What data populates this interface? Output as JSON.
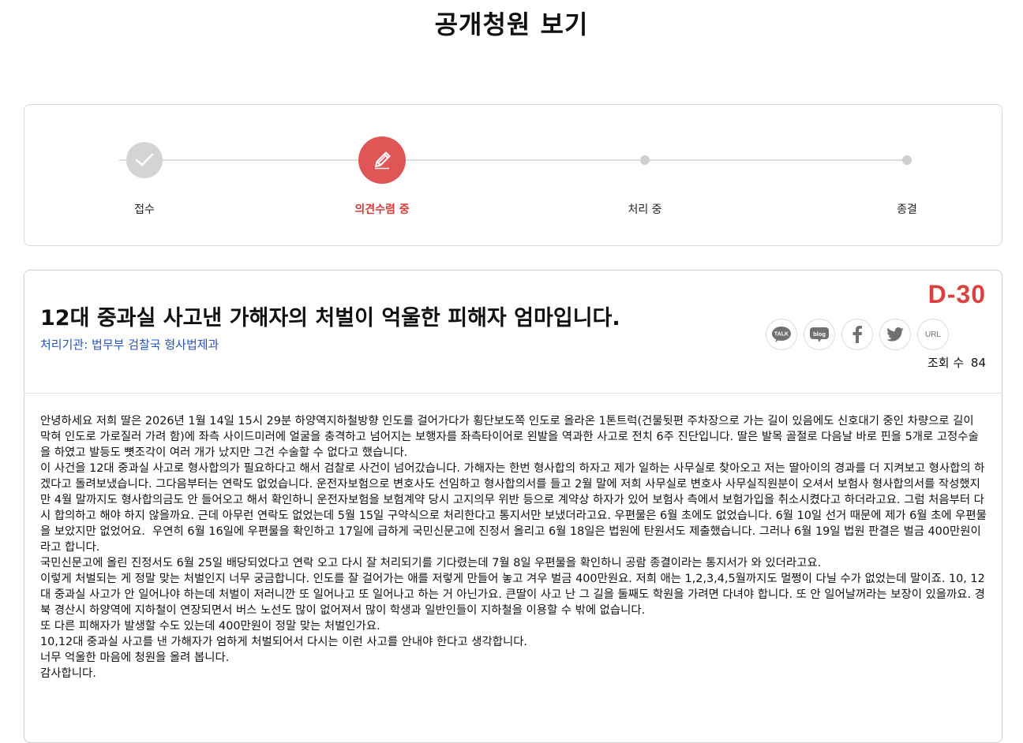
{
  "page": {
    "title": "공개청원 보기"
  },
  "progress": {
    "steps": [
      {
        "label": "접수",
        "state": "done"
      },
      {
        "label": "의견수렴 중",
        "state": "active"
      },
      {
        "label": "처리 중",
        "state": "pending"
      },
      {
        "label": "종결",
        "state": "pending"
      }
    ]
  },
  "petition": {
    "title": "12대 중과실 사고낸 가해자의 처벌이 억울한 피해자 엄마입니다.",
    "agency": "처리기관: 법무부 검찰국 형사법제과",
    "dday": "D-30",
    "views_label": "조회 수",
    "views_count": "84",
    "share": [
      {
        "name": "kakaotalk",
        "text": "TALK"
      },
      {
        "name": "blog",
        "text": "blog"
      },
      {
        "name": "facebook",
        "text": ""
      },
      {
        "name": "twitter",
        "text": ""
      },
      {
        "name": "url",
        "text": "URL"
      }
    ],
    "body": "안녕하세요 저희 딸은 2026년 1월 14일 15시 29분 하양역지하철방향 인도를 걸어가다가 횡단보도쪽 인도로 올라온 1톤트럭(건물뒷편 주차장으로 가는 길이 있음에도 신호대기 중인 차량으로 길이 막혀 인도로 가로질러 가려 함)에 좌측 사이드미러에 얼굴을 충격하고 넘어지는 보행자를 좌측타이어로 왼발을 역과한 사고로 전치 6주 진단입니다. 딸은 발목 골절로 다음날 바로 핀을 5개로 고정수술을 하였고 발등도 뼛조각이 여러 개가 났지만 그건 수술할 수 없다고 했습니다.\n이 사건을 12대 중과실 사고로 형사합의가 필요하다고 해서 검찰로 사건이 넘어갔습니다. 가해자는 한번 형사합의 하자고 제가 일하는 사무실로 찾아오고 저는 딸아이의 경과를 더 지켜보고 형사합의 하겠다고 돌려보냈습니다. 그다음부터는 연락도 없었습니다. 운전자보험으로 변호사도 선임하고 형사합의서를 들고 2월 말에 저희 사무실로 변호사 사무실직원분이 오셔서 보험사 형사합의서를 작성했지만 4월 말까지도 형사합의금도 안 들어오고 해서 확인하니 운전자보험을 보험계약 당시 고지의무 위반 등으로 계약상 하자가 있어 보험사 측에서 보험가입을 취소시켰다고 하더라고요. 그럼 처음부터 다시 합의하고 해야 하지 않을까요. 근데 아무런 연락도 없었는데 5월 15일 구약식으로 처리한다고 통지서만 보냈더라고요. 우편물은 6월 초에도 없었습니다. 6월 10일 선거 때문에 제가 6월 초에 우편물을 보았지만 없었어요.  우연히 6월 16일에 우편물을 확인하고 17일에 급하게 국민신문고에 진정서 올리고 6월 18일은 법원에 탄원서도 제출했습니다. 그러나 6월 19일 법원 판결은 벌금 400만원이라고 합니다.\n국민신문고에 올린 진정서도 6월 25일 배당되었다고 연락 오고 다시 잘 처리되기를 기다렸는데 7월 8일 우편물을 확인하니 공람 종결이라는 통지서가 와 있더라고요.\n이렇게 처벌되는 게 정말 맞는 처벌인지 너무 궁금합니다. 인도를 잘 걸어가는 애를 저렇게 만들어 놓고 겨우 벌금 400만원요. 저희 애는 1,2,3,4,5월까지도 멀쩡이 다닐 수가 없었는데 말이죠. 10, 12대 중과실 사고가 안 일어나야 하는데 처벌이 저러니깐 또 일어나고 또 일어나고 하는 거 아닌가요. 큰딸이 사고 난 그 길을 둘째도 학원을 가려면 다녀야 합니다. 또 안 일어날꺼라는 보장이 있을까요. 경북 경산시 하양역에 지하철이 연장되면서 버스 노선도 많이 없어져서 많이 학생과 일반인들이 지하철을 이용할 수 밖에 없습니다.\n또 다른 피해자가 발생할 수도 있는데 400만원이 정말 맞는 처벌인가요.\n10,12대 중과실 사고를 낸 가해자가 엄하게 처벌되어서 다시는 이런 사고를 안내야 한다고 생각합니다.\n너무 억울한 마음에 청원을 올려 봅니다.\n감사합니다."
  },
  "colors": {
    "accent_red": "#e05555",
    "agency_blue": "#2855b8"
  }
}
